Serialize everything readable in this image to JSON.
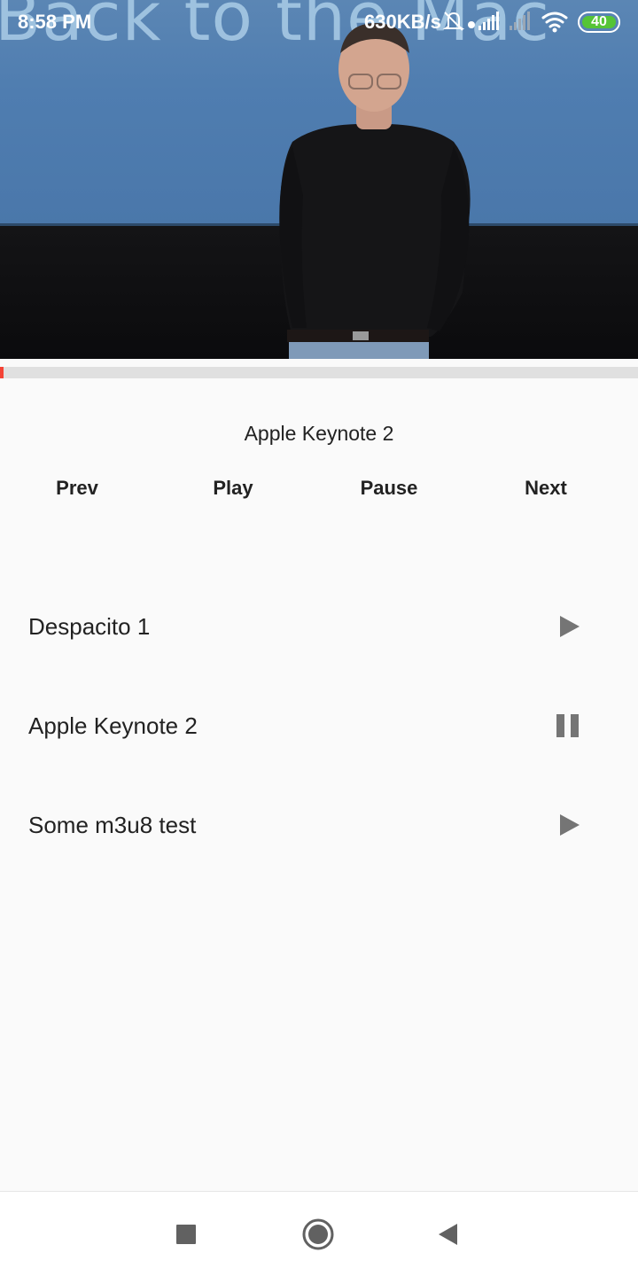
{
  "status_bar": {
    "time": "8:58 PM",
    "network_speed": "630KB/s",
    "battery_level": "40",
    "icons": [
      "alarm-off-icon",
      "signal-icon",
      "signal-muted-icon",
      "wifi-icon",
      "battery-icon"
    ]
  },
  "video": {
    "slide_text": "Back to the Mac",
    "progress_fraction": 0.006
  },
  "now_playing": {
    "title": "Apple Keynote 2"
  },
  "controls": {
    "prev": "Prev",
    "play": "Play",
    "pause": "Pause",
    "next": "Next"
  },
  "playlist": [
    {
      "title": "Despacito 1",
      "state_icon": "play-icon"
    },
    {
      "title": "Apple Keynote 2",
      "state_icon": "pause-icon"
    },
    {
      "title": "Some m3u8 test",
      "state_icon": "play-icon"
    }
  ],
  "nav_bar": {
    "icons": [
      "recents-square-icon",
      "home-circle-icon",
      "back-triangle-icon"
    ]
  },
  "colors": {
    "accent": "#f44336",
    "icon_grey": "#757575",
    "background": "#fafafa"
  }
}
